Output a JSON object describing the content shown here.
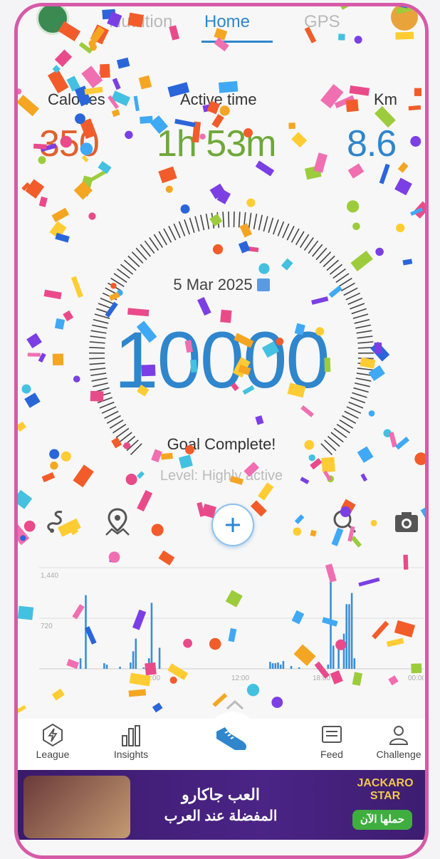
{
  "tabs": [
    {
      "label": "Nutrition",
      "active": false
    },
    {
      "label": "Home",
      "active": true
    },
    {
      "label": "GPS",
      "active": false
    }
  ],
  "stats": [
    {
      "label": "Calories",
      "value": "350",
      "color": "#e0612e"
    },
    {
      "label": "Active time",
      "value": "1h 53m",
      "color": "#6fa83a"
    },
    {
      "label": "Km",
      "value": "8.6",
      "color": "#2f86cc"
    }
  ],
  "date": "5 Mar 2025",
  "steps": "10000",
  "goal_text": "Goal Complete!",
  "level_text": "Level: Highly active",
  "tools": [
    "route-icon",
    "map-pin-icon",
    "plus-icon",
    "search-icon",
    "camera-icon"
  ],
  "chart_data": {
    "type": "bar",
    "ylim": [
      0,
      1440
    ],
    "y_ticks": [
      "1,440",
      "720"
    ],
    "x_ticks": [
      "20:00",
      "12:00",
      "18:00",
      "00:00"
    ],
    "values": [
      0,
      0,
      0,
      0,
      150,
      0,
      1050,
      0,
      0,
      0,
      0,
      0,
      0,
      80,
      60,
      0,
      0,
      0,
      0,
      30,
      0,
      0,
      0,
      90,
      250,
      430,
      0,
      0,
      20,
      0,
      150,
      940,
      0,
      0,
      300,
      0,
      0,
      0,
      0,
      0,
      0,
      0,
      0,
      0,
      0,
      0,
      0,
      0,
      0,
      0,
      0,
      0,
      0,
      0,
      0,
      0,
      0,
      0,
      0,
      0,
      0,
      0,
      0,
      0,
      0,
      0,
      0,
      0,
      0,
      0,
      0,
      0,
      0,
      0,
      0,
      0,
      100,
      80,
      80,
      90,
      60,
      110,
      0,
      0,
      40,
      0,
      0,
      20,
      0,
      0,
      0,
      0,
      0,
      0,
      10,
      0,
      0,
      0,
      60,
      1360,
      330,
      0,
      350,
      0,
      500,
      920,
      920,
      1080,
      150,
      0,
      0,
      0,
      0,
      0,
      0,
      0,
      0,
      0,
      0,
      0,
      0,
      0,
      0,
      0,
      0,
      0,
      0,
      0,
      0,
      0,
      0,
      0,
      0
    ],
    "color": "#3a8fd6"
  },
  "nav": [
    {
      "label": "League",
      "icon": "lightning-icon"
    },
    {
      "label": "Insights",
      "icon": "bar-chart-icon"
    },
    {
      "label": "",
      "icon": "shoe-icon"
    },
    {
      "label": "Feed",
      "icon": "feed-icon"
    },
    {
      "label": "Challenge",
      "icon": "challenge-icon"
    }
  ],
  "ad": {
    "line1": "العب جاكارو",
    "line2": "المفضلة عند العرب",
    "logo": "JACKARO STAR",
    "button": "حملها الآن"
  }
}
